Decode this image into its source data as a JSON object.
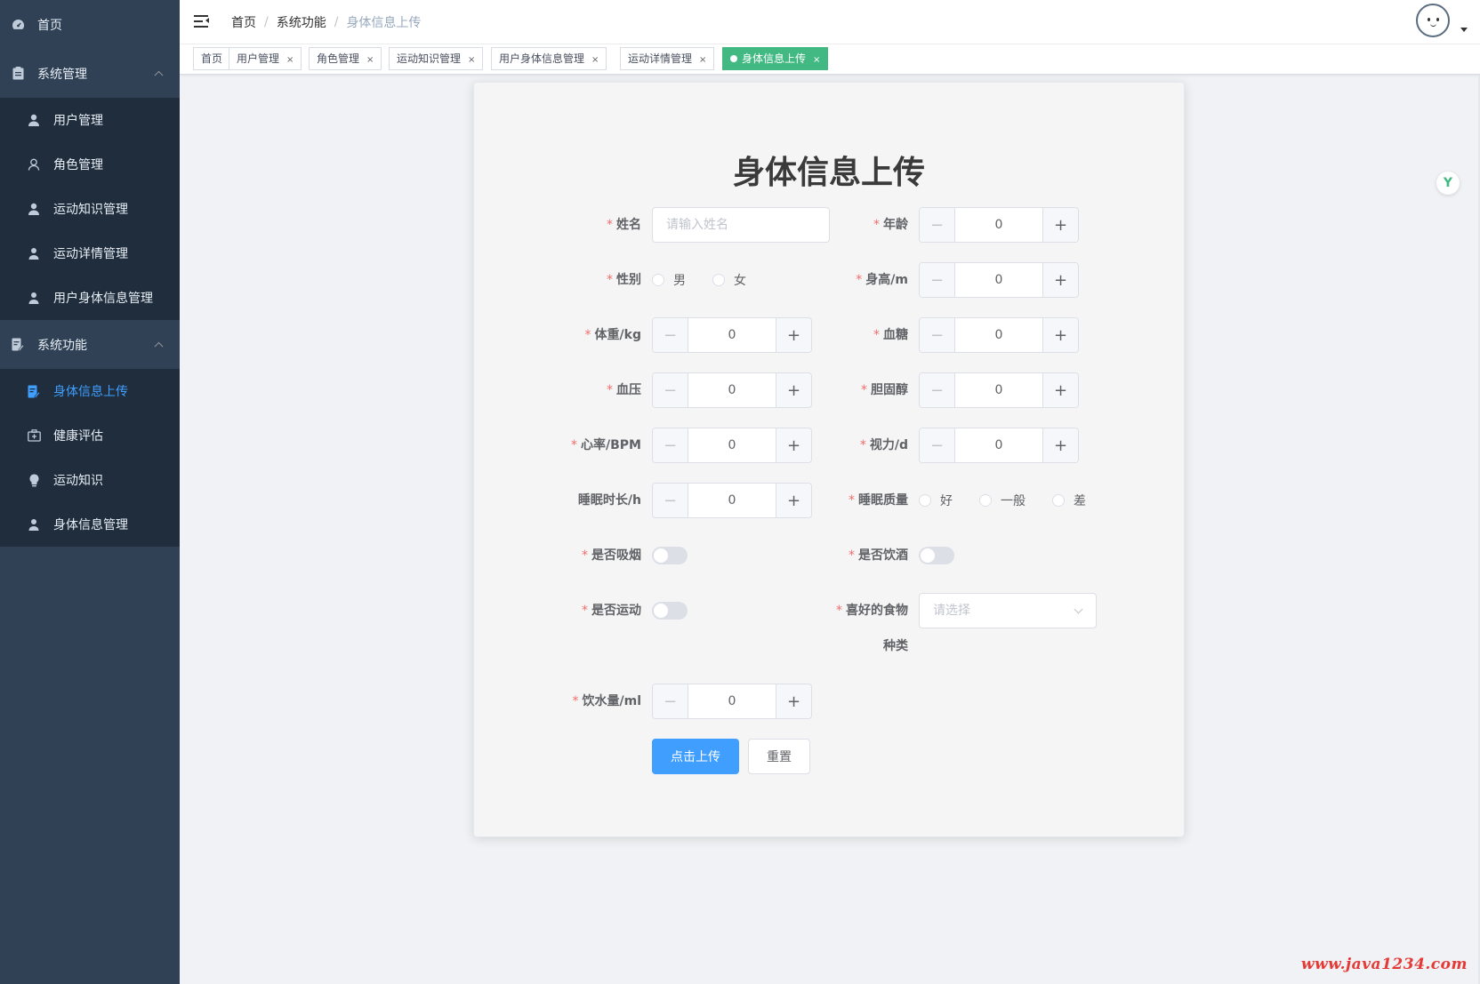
{
  "sidebar": {
    "home": "首页",
    "system_management": {
      "title": "系统管理",
      "items": [
        "用户管理",
        "角色管理",
        "运动知识管理",
        "运动详情管理",
        "用户身体信息管理"
      ]
    },
    "system_functions": {
      "title": "系统功能",
      "items": [
        "身体信息上传",
        "健康评估",
        "运动知识",
        "身体信息管理"
      ]
    }
  },
  "breadcrumb": [
    "首页",
    "系统功能",
    "身体信息上传"
  ],
  "breadcrumb_sep": "/",
  "tags": [
    {
      "label": "首页"
    },
    {
      "label": "用户管理"
    },
    {
      "label": "角色管理"
    },
    {
      "label": "运动知识管理"
    },
    {
      "label": "用户身体信息管理"
    },
    {
      "label": "运动详情管理"
    },
    {
      "label": "身体信息上传",
      "active": true
    }
  ],
  "tag_close": "×",
  "form": {
    "title": "身体信息上传",
    "required_mark": "*",
    "name": {
      "label": "姓名",
      "placeholder": "请输入姓名",
      "value": ""
    },
    "age": {
      "label": "年龄",
      "value": "0"
    },
    "gender": {
      "label": "性别",
      "options": [
        "男",
        "女"
      ]
    },
    "height": {
      "label": "身高/m",
      "value": "0"
    },
    "weight": {
      "label": "体重/kg",
      "value": "0"
    },
    "blood_sugar": {
      "label": "血糖",
      "value": "0"
    },
    "blood_pressure": {
      "label": "血压",
      "value": "0"
    },
    "cholesterol": {
      "label": "胆固醇",
      "value": "0"
    },
    "heart_rate": {
      "label": "心率/BPM",
      "value": "0"
    },
    "vision": {
      "label": "视力/d",
      "value": "0"
    },
    "sleep_hours": {
      "label": "睡眠时长/h",
      "value": "0"
    },
    "sleep_quality": {
      "label": "睡眠质量",
      "options": [
        "好",
        "一般",
        "差"
      ]
    },
    "smoking": {
      "label": "是否吸烟",
      "on": false
    },
    "drinking": {
      "label": "是否饮酒",
      "on": false
    },
    "exercise": {
      "label": "是否运动",
      "on": false
    },
    "food": {
      "label_line1": "喜好的食物",
      "label_line2": "种类",
      "placeholder": "请选择"
    },
    "water": {
      "label": "饮水量/ml",
      "value": "0"
    },
    "stepper_minus": "−",
    "stepper_plus": "+",
    "submit": "点击上传",
    "reset": "重置"
  },
  "badge": "Y",
  "watermark": "www.java1234.com",
  "colors": {
    "sidebar": "#304156",
    "submenu": "#1f2d3d",
    "accent": "#409eff",
    "tag_active": "#42b983",
    "required": "#f56c6c"
  }
}
